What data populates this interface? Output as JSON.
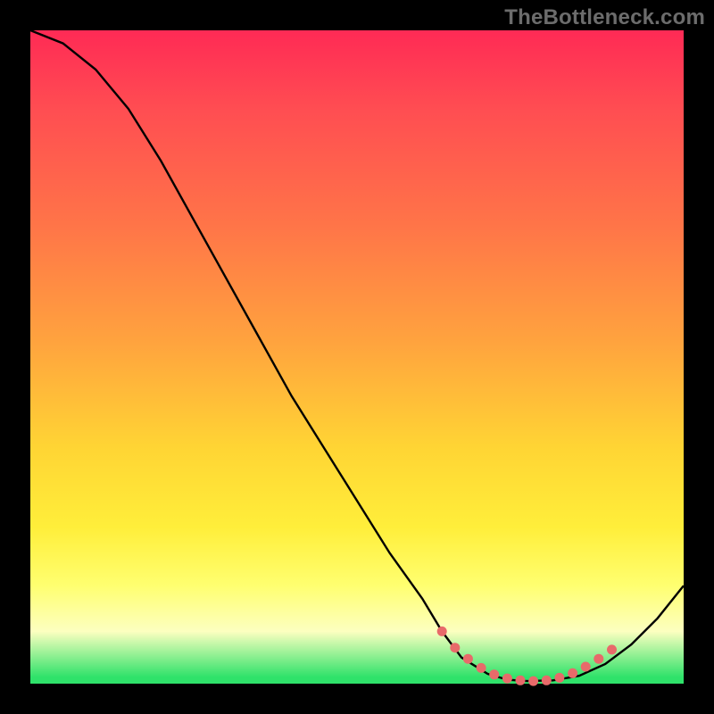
{
  "watermark": "TheBottleneck.com",
  "chart_data": {
    "type": "line",
    "title": "",
    "xlabel": "",
    "ylabel": "",
    "xlim": [
      0,
      100
    ],
    "ylim": [
      0,
      100
    ],
    "grid": false,
    "series": [
      {
        "name": "bottleneck-curve",
        "color": "#000000",
        "x": [
          0,
          5,
          10,
          15,
          20,
          25,
          30,
          35,
          40,
          45,
          50,
          55,
          60,
          63,
          66,
          70,
          73,
          76,
          80,
          84,
          88,
          92,
          96,
          100
        ],
        "y": [
          100,
          98,
          94,
          88,
          80,
          71,
          62,
          53,
          44,
          36,
          28,
          20,
          13,
          8,
          4,
          1.5,
          0.6,
          0.4,
          0.5,
          1.2,
          3,
          6,
          10,
          15
        ]
      }
    ],
    "markers": {
      "name": "highlight-dots",
      "color": "#e86a6a",
      "x": [
        63,
        65,
        67,
        69,
        71,
        73,
        75,
        77,
        79,
        81,
        83,
        85,
        87,
        89
      ],
      "y": [
        8,
        5.5,
        3.8,
        2.4,
        1.4,
        0.8,
        0.5,
        0.4,
        0.5,
        0.9,
        1.6,
        2.6,
        3.8,
        5.2
      ]
    },
    "gradient_stops": [
      {
        "pct": 0,
        "color": "#ff2a55"
      },
      {
        "pct": 12,
        "color": "#ff4d52"
      },
      {
        "pct": 30,
        "color": "#ff7548"
      },
      {
        "pct": 48,
        "color": "#ffa43e"
      },
      {
        "pct": 64,
        "color": "#ffd534"
      },
      {
        "pct": 76,
        "color": "#ffee3a"
      },
      {
        "pct": 85,
        "color": "#ffff70"
      },
      {
        "pct": 92,
        "color": "#fcffc0"
      },
      {
        "pct": 99,
        "color": "#2fe26a"
      },
      {
        "pct": 100,
        "color": "#2fe26a"
      }
    ]
  }
}
